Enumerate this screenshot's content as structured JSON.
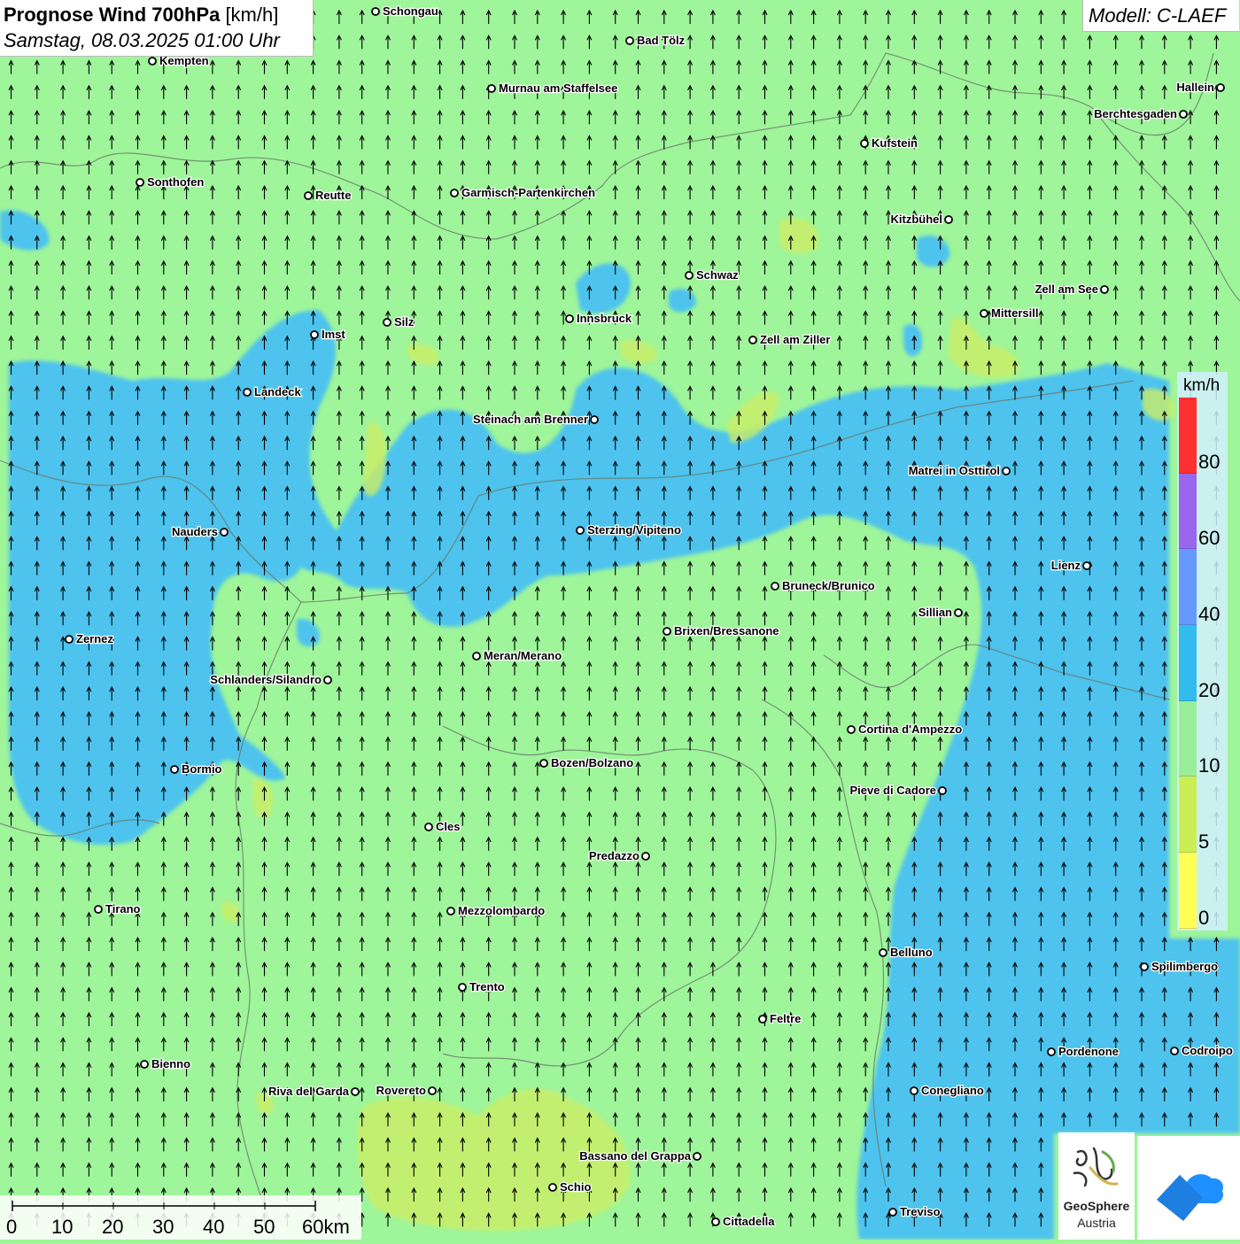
{
  "header": {
    "title_bold": "Prognose Wind 700hPa",
    "title_unit": "[km/h]",
    "datetime": "Samstag, 08.03.2025 01:00 Uhr"
  },
  "model": {
    "label": "Modell: C-LAEF"
  },
  "legend": {
    "unit": "km/h",
    "colors": [
      "#ff3030",
      "#9966ee",
      "#6699ff",
      "#33bbee",
      "#99ee99",
      "#ccee55",
      "#ffff55"
    ],
    "labels": [
      "80",
      "60",
      "40",
      "20",
      "10",
      "5",
      "0"
    ]
  },
  "scale": {
    "labels": [
      "0",
      "10",
      "20",
      "30",
      "40",
      "50",
      "60km"
    ]
  },
  "logos": {
    "geosphere_line1": "GeoSphere",
    "geosphere_line2": "Austria"
  },
  "map": {
    "wind_direction": "north",
    "cities": [
      {
        "name": "Schongau"
      },
      {
        "name": "Bad Tölz"
      },
      {
        "name": "Kempten"
      },
      {
        "name": "Murnau am Staffelsee"
      },
      {
        "name": "Hallein"
      },
      {
        "name": "Berchtesgaden"
      },
      {
        "name": "Kufstein"
      },
      {
        "name": "Sonthofen"
      },
      {
        "name": "Reutte"
      },
      {
        "name": "Garmisch-Partenkirchen"
      },
      {
        "name": "Kitzbühel"
      },
      {
        "name": "Schwaz"
      },
      {
        "name": "Zell am See"
      },
      {
        "name": "Mittersill"
      },
      {
        "name": "Innsbruck"
      },
      {
        "name": "Imst"
      },
      {
        "name": "Silz"
      },
      {
        "name": "Zell am Ziller"
      },
      {
        "name": "Landeck"
      },
      {
        "name": "Steinach am Brenner"
      },
      {
        "name": "Matrei in Osttirol"
      },
      {
        "name": "Nauders"
      },
      {
        "name": "Sterzing/Vipiteno"
      },
      {
        "name": "Lienz"
      },
      {
        "name": "Bruneck/Brunico"
      },
      {
        "name": "Sillian"
      },
      {
        "name": "Brixen/Bressanone"
      },
      {
        "name": "Zernez"
      },
      {
        "name": "Meran/Merano"
      },
      {
        "name": "Schlanders/Silandro"
      },
      {
        "name": "Cortina d'Ampezzo"
      },
      {
        "name": "Bozen/Bolzano"
      },
      {
        "name": "Bormio"
      },
      {
        "name": "Pieve di Cadore"
      },
      {
        "name": "Cles"
      },
      {
        "name": "Predazzo"
      },
      {
        "name": "Tirano"
      },
      {
        "name": "Mezzolombardo"
      },
      {
        "name": "Belluno"
      },
      {
        "name": "Spilimbergo"
      },
      {
        "name": "Trento"
      },
      {
        "name": "Feltre"
      },
      {
        "name": "Pordenone"
      },
      {
        "name": "Codroipo"
      },
      {
        "name": "Bienno"
      },
      {
        "name": "Riva del Garda"
      },
      {
        "name": "Rovereto"
      },
      {
        "name": "Conegliano"
      },
      {
        "name": "Bassano del Grappa"
      },
      {
        "name": "Schio"
      },
      {
        "name": "Treviso"
      },
      {
        "name": "Cittadella"
      }
    ]
  }
}
